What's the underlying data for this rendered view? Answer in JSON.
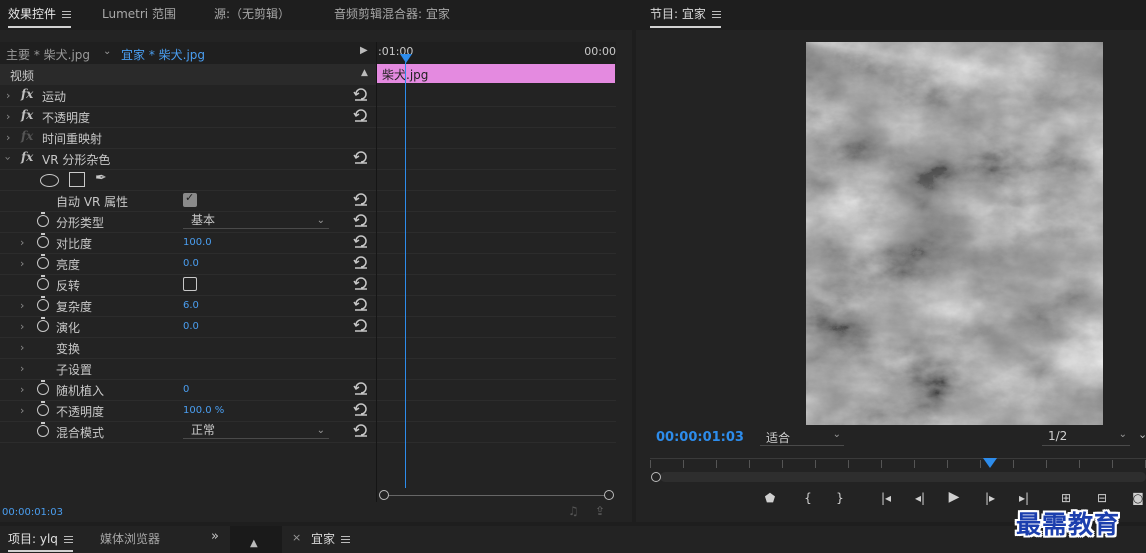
{
  "effect_controls": {
    "tabs": [
      {
        "label": "效果控件",
        "active": true
      },
      {
        "label": "Lumetri 范围",
        "active": false
      },
      {
        "label": "源:（无剪辑）",
        "active": false
      },
      {
        "label": "音频剪辑混合器: 宜家",
        "active": false
      }
    ],
    "source_tab": "主要 * 柴犬.jpg",
    "sequence_tab": "宜家 * 柴犬.jpg",
    "section_video": "视频",
    "timecode_start": ":01:00",
    "timecode_end": "00:00",
    "clip_label": "柴犬.jpg",
    "effects": {
      "motion": "运动",
      "opacity": "不透明度",
      "time_remap": "时间重映射",
      "vr_fractal": "VR 分形杂色"
    },
    "params": {
      "auto_vr": {
        "label": "自动 VR 属性",
        "checked": true
      },
      "fractal_type": {
        "label": "分形类型",
        "value": "基本"
      },
      "contrast": {
        "label": "对比度",
        "value": "100.0"
      },
      "brightness": {
        "label": "亮度",
        "value": "0.0"
      },
      "invert": {
        "label": "反转",
        "checked": false
      },
      "complexity": {
        "label": "复杂度",
        "value": "6.0"
      },
      "evolution": {
        "label": "演化",
        "value": "0.0"
      },
      "transform": {
        "label": "变换"
      },
      "sub_settings": {
        "label": "子设置"
      },
      "random_seed": {
        "label": "随机植入",
        "value": "0"
      },
      "opacity": {
        "label": "不透明度",
        "value": "100.0 %"
      },
      "blend_mode": {
        "label": "混合模式",
        "value": "正常"
      }
    },
    "bottom_timecode": "00:00:01:03"
  },
  "program_monitor": {
    "title": "节目: 宜家",
    "timecode": "00:00:01:03",
    "fit": "适合",
    "resolution": "1/2"
  },
  "bottom_bar": {
    "project_tab": "项目: ylq",
    "media_browser": "媒体浏览器",
    "timeline_tab": "宜家"
  },
  "watermark": "最需教育",
  "colors": {
    "accent_blue": "#2d8ceb",
    "clip_pink": "#e48ae0",
    "bg": "#232323"
  }
}
